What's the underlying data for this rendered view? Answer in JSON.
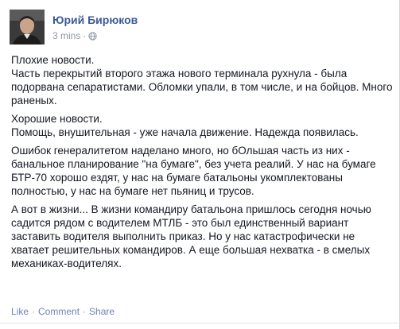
{
  "post": {
    "author": "Юрий Бирюков",
    "time": "3 mins",
    "dot": "·",
    "privacy_icon": "globe-icon",
    "paragraphs": [
      "Плохие новости.\nЧасть перекрытий второго этажа нового терминала рухнула - была подорвана сепаратистами. Обломки упали, в том числе, и на бойцов. Много раненых.",
      "Хорошие новости.\nПомощь, внушительная - уже начала движение. Надежда появилась.",
      "Ошибок генералитетом наделано много, но бОльшая часть из них - банальное планирование \"на бумаге\", без учета реалий. У нас на бумаге БТР-70 хорошо ездят, у нас на бумаге батальоны укомплектованы полностью, у нас на бумаге нет пьяниц и трусов.",
      "А вот в жизни... В жизни командиру батальона пришлось сегодня ночью садится рядом с водителем МТЛБ - это был единственный вариант заставить водителя выполнить приказ. Но у нас катастрофически не хватает решительных командиров. А еще большая нехватка - в смелых механиках-водителях."
    ]
  },
  "actions": {
    "like": "Like",
    "comment": "Comment",
    "share": "Share",
    "sep": "·"
  },
  "colors": {
    "link": "#3b5998",
    "action": "#6d84b4",
    "meta": "#9197a3",
    "text": "#141823"
  }
}
